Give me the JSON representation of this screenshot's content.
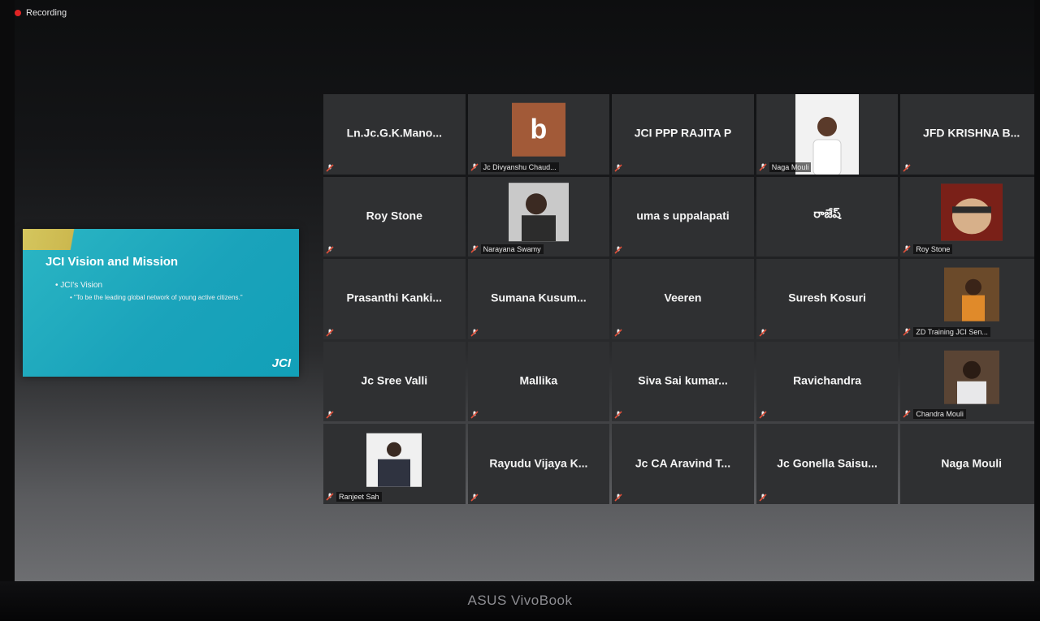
{
  "recording": {
    "label": "Recording"
  },
  "slide": {
    "title": "JCI Vision and Mission",
    "bullet": "• JCI's Vision",
    "subbullet": "• \"To be the leading global network of young active citizens.\"",
    "logo": "JCI"
  },
  "participants": [
    {
      "name": "Ln.Jc.G.K.Mano...",
      "footer": ""
    },
    {
      "name": "",
      "footer": "Jc Divyanshu Chaud...",
      "avatar_letter": "b"
    },
    {
      "name": "JCI PPP RAJITA P",
      "footer": ""
    },
    {
      "name": "",
      "footer": "Naga Mouli"
    },
    {
      "name": "JFD KRISHNA B...",
      "footer": ""
    },
    {
      "name": "Roy Stone",
      "footer": ""
    },
    {
      "name": "",
      "footer": "Narayana Swamy"
    },
    {
      "name": "uma s uppalapati",
      "footer": ""
    },
    {
      "name": "రాజేష్",
      "footer": ""
    },
    {
      "name": "",
      "footer": "Roy Stone"
    },
    {
      "name": "Prasanthi Kanki...",
      "footer": ""
    },
    {
      "name": "Sumana Kusum...",
      "footer": ""
    },
    {
      "name": "Veeren",
      "footer": ""
    },
    {
      "name": "Suresh Kosuri",
      "footer": ""
    },
    {
      "name": "",
      "footer": "ZD Training JCI Sen..."
    },
    {
      "name": "Jc Sree Valli",
      "footer": ""
    },
    {
      "name": "Mallika",
      "footer": ""
    },
    {
      "name": "Siva Sai kumar...",
      "footer": ""
    },
    {
      "name": "Ravichandra",
      "footer": ""
    },
    {
      "name": "",
      "footer": "Chandra Mouli"
    },
    {
      "name": "",
      "footer": "Ranjeet Sah"
    },
    {
      "name": "Rayudu Vijaya K...",
      "footer": ""
    },
    {
      "name": "Jc CA Aravind T...",
      "footer": ""
    },
    {
      "name": "Jc Gonella Saisu...",
      "footer": ""
    },
    {
      "name": "Naga Mouli",
      "footer": ""
    }
  ],
  "brand": "ASUS VivoBook",
  "colors": {
    "mute_icon": "#e0503a",
    "tile_bg": "#2f3032",
    "slide_bg": "#1aa3bb"
  }
}
